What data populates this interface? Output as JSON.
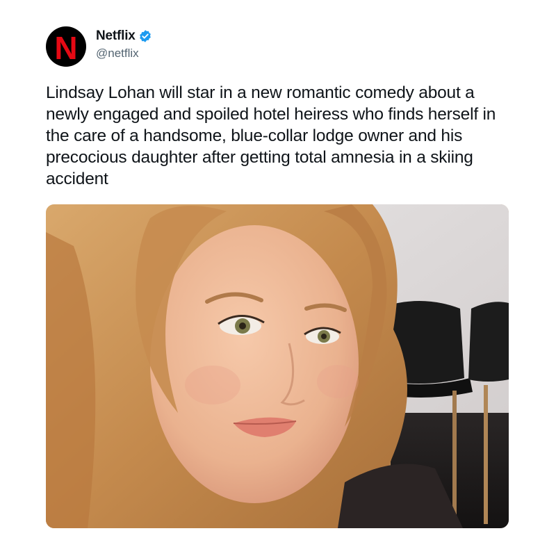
{
  "account": {
    "display_name": "Netflix",
    "handle": "@netflix",
    "verified": true,
    "avatar_icon": "netflix-logo-icon",
    "avatar_letter": "N",
    "brand_color": "#E50914"
  },
  "tweet": {
    "text": "Lindsay Lohan will star in a new romantic comedy about a newly engaged and spoiled hotel heiress who finds herself in the care of a handsome, blue-collar lodge owner and his precocious daughter after getting total amnesia in a skiing accident"
  },
  "colors": {
    "text": "#0f1419",
    "handle": "#536471",
    "verified_badge": "#1d9bf0"
  }
}
